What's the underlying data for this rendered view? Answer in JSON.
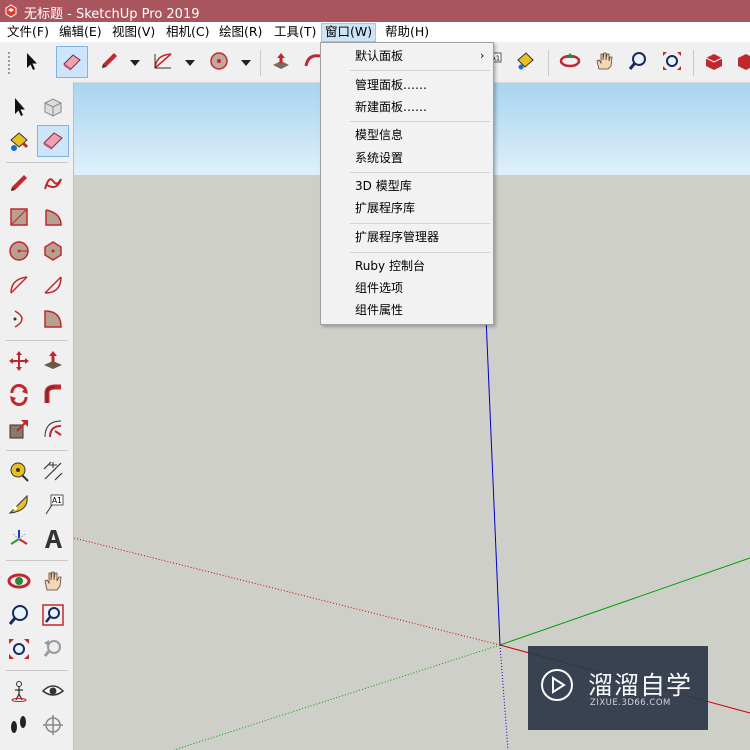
{
  "window": {
    "title": "无标题 - SketchUp Pro 2019"
  },
  "menubar": {
    "items": [
      {
        "label": "文件(F)"
      },
      {
        "label": "编辑(E)"
      },
      {
        "label": "视图(V)"
      },
      {
        "label": "相机(C)"
      },
      {
        "label": "绘图(R)"
      },
      {
        "label": "工具(T)"
      },
      {
        "label": "窗口(W)"
      },
      {
        "label": "帮助(H)"
      }
    ],
    "active": "窗口(W)"
  },
  "window_menu": {
    "items": [
      {
        "label": "默认面板",
        "has_submenu": true
      },
      {
        "label": "管理面板……"
      },
      {
        "label": "新建面板……"
      },
      {
        "label": "模型信息"
      },
      {
        "label": "系统设置"
      },
      {
        "label": "3D 模型库"
      },
      {
        "label": "扩展程序库"
      },
      {
        "label": "扩展程序管理器"
      },
      {
        "label": "Ruby 控制台"
      },
      {
        "label": "组件选项"
      },
      {
        "label": "组件属性"
      }
    ]
  },
  "toolbar": {
    "tools": [
      "select-tool",
      "eraser-tool",
      "pencil-tool",
      "arc-tool",
      "polygon-tool",
      "push-pull-tool",
      "follow-me-tool",
      "text-tool",
      "paint-bucket-tool",
      "orbit-tool",
      "pan-tool",
      "zoom-tool",
      "zoom-extents-tool",
      "3d-warehouse-tool",
      "extension-warehouse-tool"
    ],
    "active_tool": "eraser-tool",
    "text_tool_label": "A1"
  },
  "left_toolbar": {
    "text_tool_label": "A1",
    "active_tool": "eraser-tool"
  },
  "watermark": {
    "brand": "溜溜自学",
    "url": "ZIXUE.3D66.COM"
  },
  "colors": {
    "titlebar": "#a9555d",
    "menu_active": "#cce4f7",
    "axis_red": "#cc0000",
    "axis_green": "#00a000",
    "axis_blue": "#0000c8"
  }
}
